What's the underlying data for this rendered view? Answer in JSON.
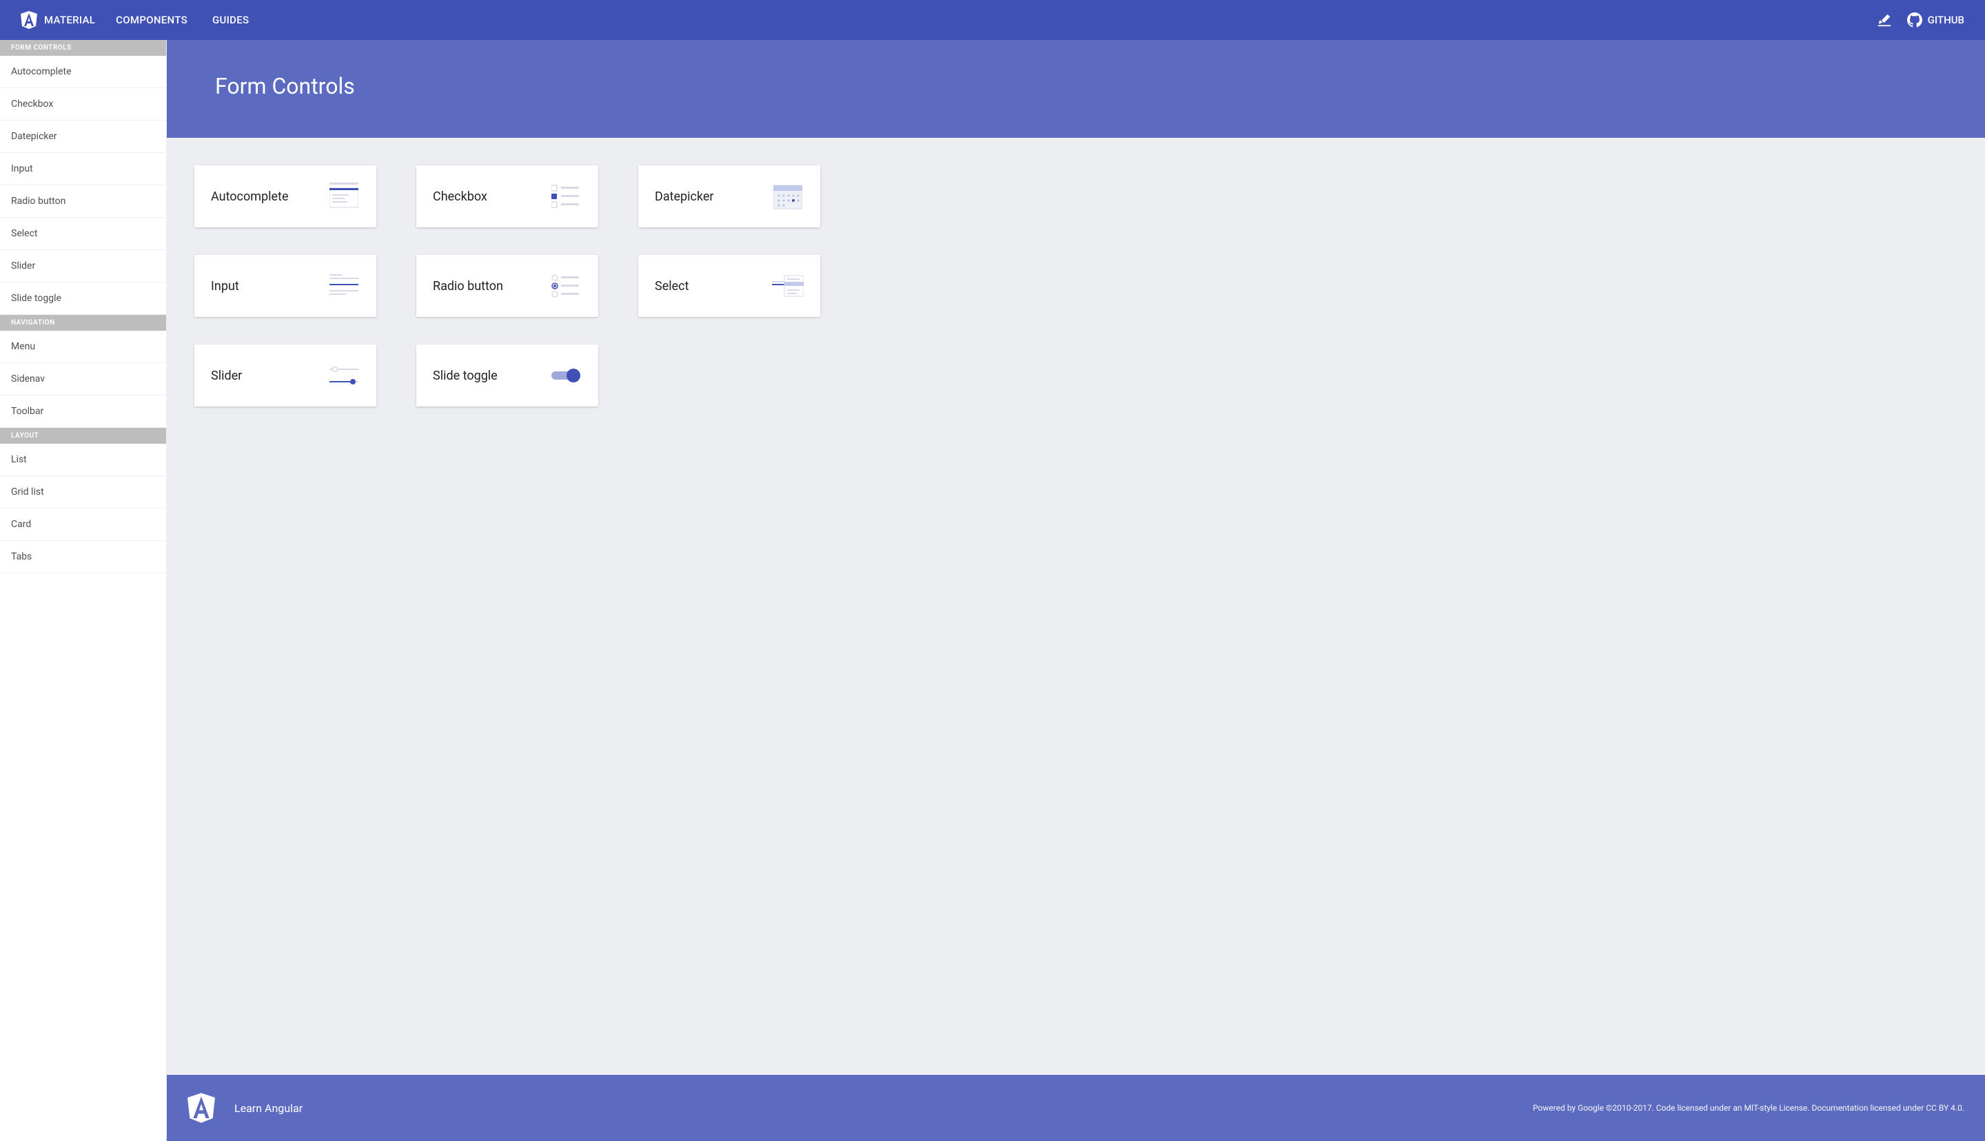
{
  "brand": {
    "name": "MATERIAL"
  },
  "nav": {
    "components": "COMPONENTS",
    "guides": "GUIDES",
    "github": "GITHUB"
  },
  "sidebar": {
    "groups": [
      {
        "header": "FORM CONTROLS",
        "items": [
          "Autocomplete",
          "Checkbox",
          "Datepicker",
          "Input",
          "Radio button",
          "Select",
          "Slider",
          "Slide toggle"
        ]
      },
      {
        "header": "NAVIGATION",
        "items": [
          "Menu",
          "Sidenav",
          "Toolbar"
        ]
      },
      {
        "header": "LAYOUT",
        "items": [
          "List",
          "Grid list",
          "Card",
          "Tabs"
        ]
      }
    ]
  },
  "page": {
    "title": "Form Controls"
  },
  "cards": [
    {
      "label": "Autocomplete",
      "icon": "autocomplete"
    },
    {
      "label": "Checkbox",
      "icon": "checkbox"
    },
    {
      "label": "Datepicker",
      "icon": "datepicker"
    },
    {
      "label": "Input",
      "icon": "input"
    },
    {
      "label": "Radio button",
      "icon": "radio"
    },
    {
      "label": "Select",
      "icon": "select"
    },
    {
      "label": "Slider",
      "icon": "slider"
    },
    {
      "label": "Slide toggle",
      "icon": "slidetoggle"
    }
  ],
  "footer": {
    "learn": "Learn Angular",
    "legal": "Powered by Google ©2010-2017. Code licensed under an MIT-style License. Documentation licensed under CC BY 4.0."
  },
  "colors": {
    "primary": "#3f51b5",
    "primaryLight": "#5c6bc0",
    "iconStroke": "#d7d9e6",
    "iconAccent": "#3f51b5"
  }
}
